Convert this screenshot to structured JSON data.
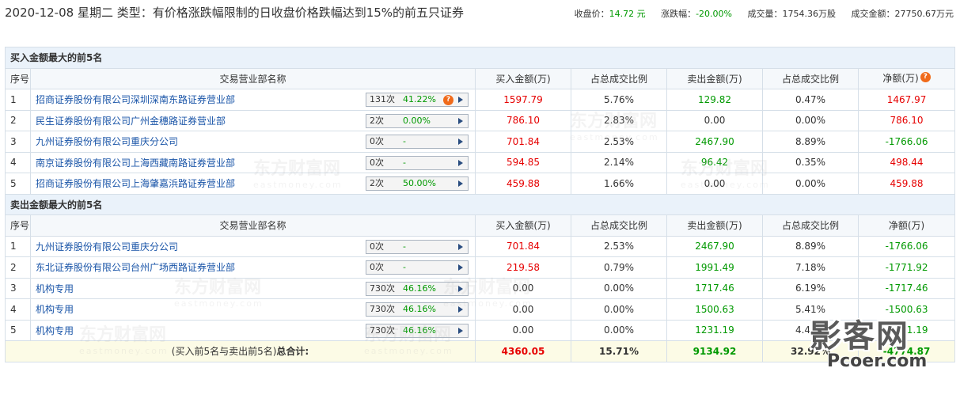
{
  "header": {
    "title": "2020-12-08 星期二  类型：有价格涨跌幅限制的日收盘价格跌幅达到15%的前五只证券",
    "close_label": "收盘价：",
    "close_value": "14.72 元",
    "change_label": "涨跌幅：",
    "change_value": "-20.00%",
    "volume_label": "成交量：",
    "volume_value": "1754.36万股",
    "amount_label": "成交金额：",
    "amount_value": "27750.67万元"
  },
  "columns": {
    "idx": "序号",
    "name": "交易营业部名称",
    "buy": "买入金额(万)",
    "buy_pct": "占总成交比例",
    "sell": "卖出金额(万)",
    "sell_pct": "占总成交比例",
    "net": "净额(万)"
  },
  "buy_section": {
    "title": "买入金额最大的前5名",
    "rows": [
      {
        "idx": "1",
        "name": "招商证券股份有限公司深圳深南东路证券营业部",
        "count": "131次",
        "rate": "41.22%",
        "buy": "1597.79",
        "buy_pct": "5.76%",
        "sell": "129.82",
        "sell_pct": "0.47%",
        "net": "1467.97"
      },
      {
        "idx": "2",
        "name": "民生证券股份有限公司广州金穗路证券营业部",
        "count": "2次",
        "rate": "0.00%",
        "buy": "786.10",
        "buy_pct": "2.83%",
        "sell": "0.00",
        "sell_pct": "0.00%",
        "net": "786.10"
      },
      {
        "idx": "3",
        "name": "九州证券股份有限公司重庆分公司",
        "count": "0次",
        "rate": "-",
        "buy": "701.84",
        "buy_pct": "2.53%",
        "sell": "2467.90",
        "sell_pct": "8.89%",
        "net": "-1766.06"
      },
      {
        "idx": "4",
        "name": "南京证券股份有限公司上海西藏南路证券营业部",
        "count": "0次",
        "rate": "-",
        "buy": "594.85",
        "buy_pct": "2.14%",
        "sell": "96.42",
        "sell_pct": "0.35%",
        "net": "498.44"
      },
      {
        "idx": "5",
        "name": "招商证券股份有限公司上海肇嘉浜路证券营业部",
        "count": "2次",
        "rate": "50.00%",
        "buy": "459.88",
        "buy_pct": "1.66%",
        "sell": "0.00",
        "sell_pct": "0.00%",
        "net": "459.88"
      }
    ]
  },
  "sell_section": {
    "title": "卖出金额最大的前5名",
    "rows": [
      {
        "idx": "1",
        "name": "九州证券股份有限公司重庆分公司",
        "count": "0次",
        "rate": "-",
        "buy": "701.84",
        "buy_pct": "2.53%",
        "sell": "2467.90",
        "sell_pct": "8.89%",
        "net": "-1766.06"
      },
      {
        "idx": "2",
        "name": "东北证券股份有限公司台州广场西路证券营业部",
        "count": "0次",
        "rate": "-",
        "buy": "219.58",
        "buy_pct": "0.79%",
        "sell": "1991.49",
        "sell_pct": "7.18%",
        "net": "-1771.92"
      },
      {
        "idx": "3",
        "name": "机构专用",
        "count": "730次",
        "rate": "46.16%",
        "buy": "0.00",
        "buy_pct": "0.00%",
        "sell": "1717.46",
        "sell_pct": "6.19%",
        "net": "-1717.46"
      },
      {
        "idx": "4",
        "name": "机构专用",
        "count": "730次",
        "rate": "46.16%",
        "buy": "0.00",
        "buy_pct": "0.00%",
        "sell": "1500.63",
        "sell_pct": "5.41%",
        "net": "-1500.63"
      },
      {
        "idx": "5",
        "name": "机构专用",
        "count": "730次",
        "rate": "46.16%",
        "buy": "0.00",
        "buy_pct": "0.00%",
        "sell": "1231.19",
        "sell_pct": "4.44%",
        "net": "-1231.19"
      }
    ]
  },
  "total": {
    "label_prefix": "(买入前5名与卖出前5名)",
    "label_bold": "总合计:",
    "buy": "4360.05",
    "buy_pct": "15.71%",
    "sell": "9134.92",
    "sell_pct": "32.92%",
    "net": "-4774.87"
  },
  "watermark": {
    "text": "东方财富网",
    "sub": "eastmoney.com"
  },
  "corner_logo": {
    "big": "影客网",
    "small": "Pcoer.com"
  }
}
